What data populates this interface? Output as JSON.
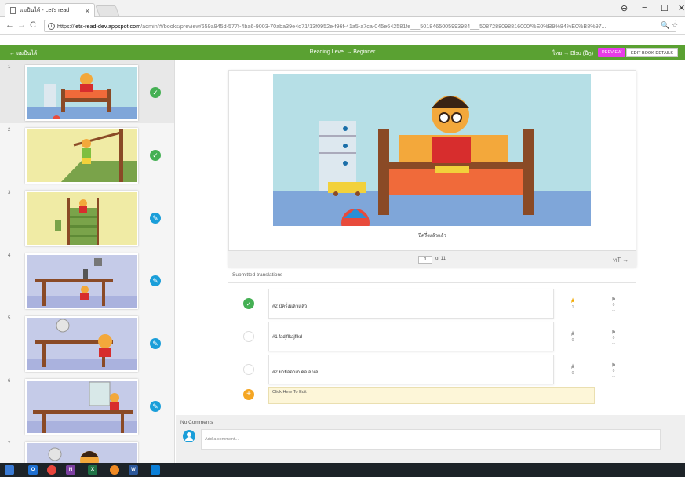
{
  "browser": {
    "tab_title": "แมปืนได้ - Let's read",
    "url_scheme": "https://",
    "url_host": "lets-read-dev.appspot.com",
    "url_path": "/admin/#/books/preview/659a945d-577f-4ba6-9003-70aba39e4d71/13f0952e-f96f-41a5-a7ca-045e642581fe___5018465005993984___5087288098816000/%E0%B9%84%E0%B8%97..."
  },
  "header": {
    "back_label": "← แมปืนได้",
    "reading_level": "Reading Level → Beginner",
    "language": "ไทย → Blsu (ปีกู)",
    "preview_label": "PREVIEW",
    "edit_details_label": "EDIT BOOK DETAILS"
  },
  "sidebar": {
    "pages": [
      {
        "num": "1",
        "status": "done"
      },
      {
        "num": "2",
        "status": "done"
      },
      {
        "num": "3",
        "status": "edit"
      },
      {
        "num": "4",
        "status": "edit"
      },
      {
        "num": "5",
        "status": "edit"
      },
      {
        "num": "6",
        "status": "edit"
      },
      {
        "num": "7",
        "status": "none"
      }
    ]
  },
  "page_view": {
    "caption": "ปีครึ่งแล้วแล้ว",
    "current_page": "1",
    "page_of": "of 11",
    "tools": "ทT →"
  },
  "translations": {
    "section_title": "Submitted translations",
    "items": [
      {
        "text": "#2 ปีครึ่งแล้วแล้ว",
        "stars": "1",
        "flags": "0",
        "selected": true
      },
      {
        "text": "#1 fadjflkajflkd",
        "stars": "0",
        "flags": "0",
        "selected": false
      },
      {
        "text": "#2 ยายืออาเก ดอ อาเอ.",
        "stars": "0",
        "flags": "0",
        "selected": false
      }
    ],
    "edit_placeholder": "Click Here To Edit"
  },
  "comments": {
    "title": "No Comments",
    "placeholder": "Add a comment..."
  }
}
